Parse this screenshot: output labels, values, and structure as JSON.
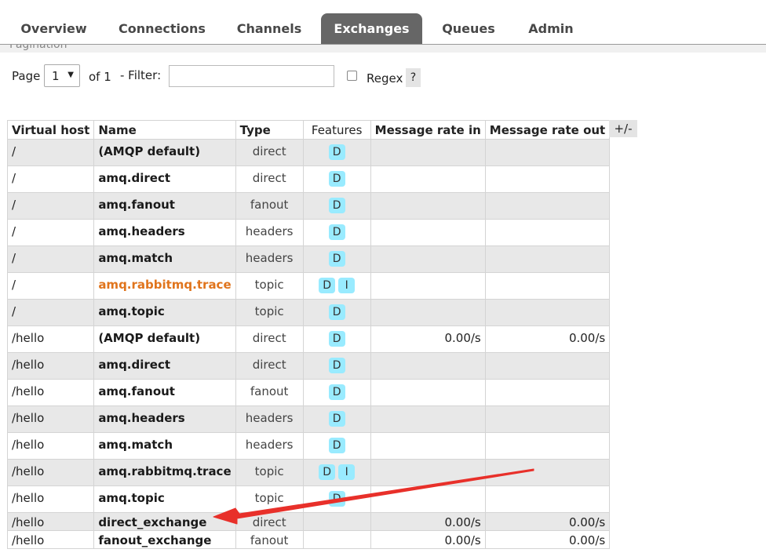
{
  "nav": {
    "tabs": [
      {
        "label": "Overview",
        "active": false
      },
      {
        "label": "Connections",
        "active": false
      },
      {
        "label": "Channels",
        "active": false
      },
      {
        "label": "Exchanges",
        "active": true
      },
      {
        "label": "Queues",
        "active": false
      },
      {
        "label": "Admin",
        "active": false
      }
    ]
  },
  "section_heading": "Pagination",
  "pagination": {
    "page_label": "Page",
    "page_value": "1",
    "of_label": "of 1",
    "filter_label": "- Filter:",
    "filter_value": "",
    "regex_label": "Regex",
    "regex_checked": false,
    "help_label": "?"
  },
  "table": {
    "columns": [
      "Virtual host",
      "Name",
      "Type",
      "Features",
      "Message rate in",
      "Message rate out"
    ],
    "toggle_label": "+/-",
    "rows": [
      {
        "vhost": "/",
        "name": "(AMQP default)",
        "type": "direct",
        "features": [
          "D"
        ],
        "rate_in": "",
        "rate_out": ""
      },
      {
        "vhost": "/",
        "name": "amq.direct",
        "type": "direct",
        "features": [
          "D"
        ],
        "rate_in": "",
        "rate_out": ""
      },
      {
        "vhost": "/",
        "name": "amq.fanout",
        "type": "fanout",
        "features": [
          "D"
        ],
        "rate_in": "",
        "rate_out": ""
      },
      {
        "vhost": "/",
        "name": "amq.headers",
        "type": "headers",
        "features": [
          "D"
        ],
        "rate_in": "",
        "rate_out": ""
      },
      {
        "vhost": "/",
        "name": "amq.match",
        "type": "headers",
        "features": [
          "D"
        ],
        "rate_in": "",
        "rate_out": ""
      },
      {
        "vhost": "/",
        "name": "amq.rabbitmq.trace",
        "type": "topic",
        "features": [
          "D",
          "I"
        ],
        "rate_in": "",
        "rate_out": "",
        "highlight": true
      },
      {
        "vhost": "/",
        "name": "amq.topic",
        "type": "topic",
        "features": [
          "D"
        ],
        "rate_in": "",
        "rate_out": ""
      },
      {
        "vhost": "/hello",
        "name": "(AMQP default)",
        "type": "direct",
        "features": [
          "D"
        ],
        "rate_in": "0.00/s",
        "rate_out": "0.00/s"
      },
      {
        "vhost": "/hello",
        "name": "amq.direct",
        "type": "direct",
        "features": [
          "D"
        ],
        "rate_in": "",
        "rate_out": ""
      },
      {
        "vhost": "/hello",
        "name": "amq.fanout",
        "type": "fanout",
        "features": [
          "D"
        ],
        "rate_in": "",
        "rate_out": ""
      },
      {
        "vhost": "/hello",
        "name": "amq.headers",
        "type": "headers",
        "features": [
          "D"
        ],
        "rate_in": "",
        "rate_out": ""
      },
      {
        "vhost": "/hello",
        "name": "amq.match",
        "type": "headers",
        "features": [
          "D"
        ],
        "rate_in": "",
        "rate_out": ""
      },
      {
        "vhost": "/hello",
        "name": "amq.rabbitmq.trace",
        "type": "topic",
        "features": [
          "D",
          "I"
        ],
        "rate_in": "",
        "rate_out": ""
      },
      {
        "vhost": "/hello",
        "name": "amq.topic",
        "type": "topic",
        "features": [
          "D"
        ],
        "rate_in": "",
        "rate_out": ""
      },
      {
        "vhost": "/hello",
        "name": "direct_exchange",
        "type": "direct",
        "features": [],
        "rate_in": "0.00/s",
        "rate_out": "0.00/s",
        "compact": true
      },
      {
        "vhost": "/hello",
        "name": "fanout_exchange",
        "type": "fanout",
        "features": [],
        "rate_in": "0.00/s",
        "rate_out": "0.00/s",
        "compact": true
      }
    ]
  },
  "colors": {
    "active_tab": "#666666",
    "feature_badge": "#99ebff",
    "highlight_name": "#e0741c",
    "annotation_arrow": "#e8302a"
  }
}
